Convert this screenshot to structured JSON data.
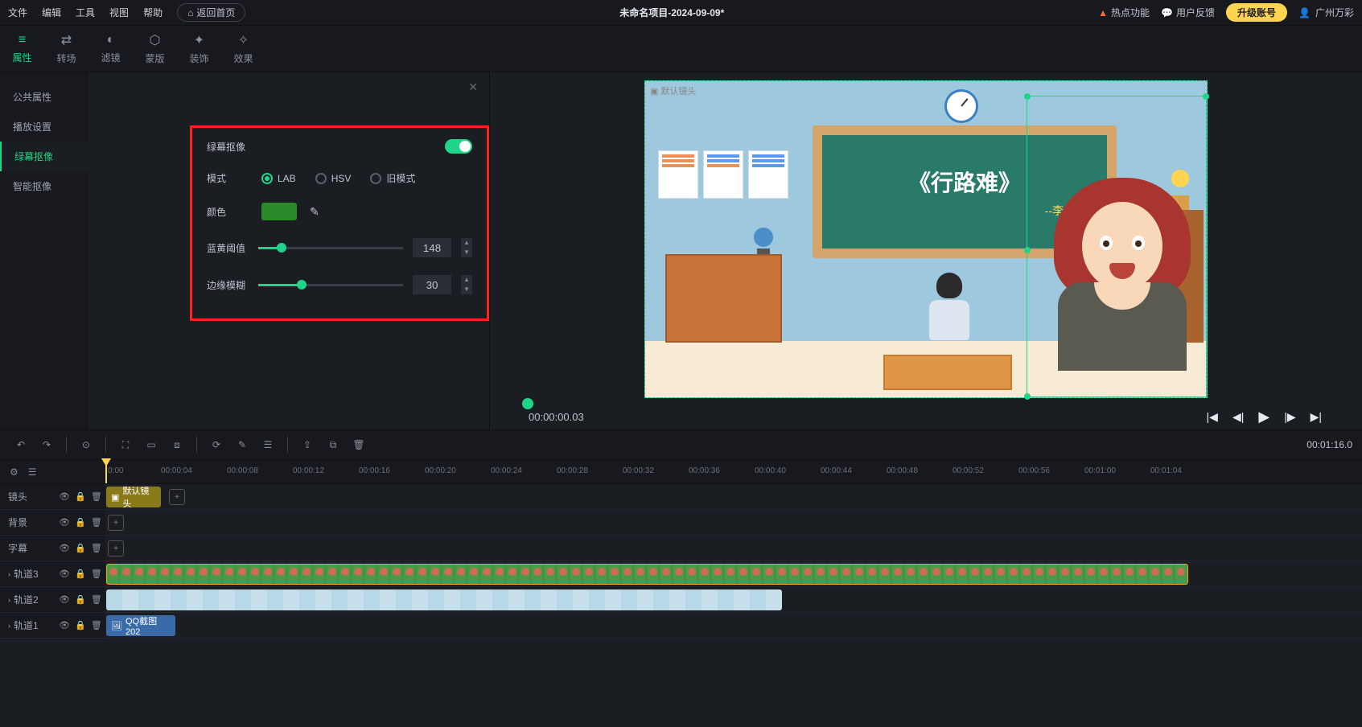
{
  "menubar": {
    "items": [
      "文件",
      "编辑",
      "工具",
      "视图",
      "帮助"
    ],
    "home": "返回首页",
    "title": "未命名项目-2024-09-09*",
    "hot": "热点功能",
    "feedback": "用户反馈",
    "upgrade": "升级账号",
    "user": "广州万彩"
  },
  "tooltabs": [
    {
      "icon": "☰",
      "label": "属性"
    },
    {
      "icon": "⇄",
      "label": "转场"
    },
    {
      "icon": "◐",
      "label": "滤镜"
    },
    {
      "icon": "⬡",
      "label": "蒙版"
    },
    {
      "icon": "✦",
      "label": "装饰"
    },
    {
      "icon": "✧",
      "label": "效果"
    }
  ],
  "sidelist": [
    "公共属性",
    "播放设置",
    "绿幕抠像",
    "智能抠像"
  ],
  "panel": {
    "title": "绿幕抠像",
    "mode_label": "模式",
    "modes": [
      "LAB",
      "HSV",
      "旧模式"
    ],
    "color_label": "颜色",
    "color_value": "#2a8a2a",
    "slider1_label": "蓝黄阈值",
    "slider1_value": "148",
    "slider2_label": "边缘模糊",
    "slider2_value": "30"
  },
  "preview": {
    "cam_label": "默认镜头",
    "blackboard_title": "《行路难》",
    "blackboard_sub": "--李白"
  },
  "playback": {
    "time": "00:00:00.03"
  },
  "tl_toolbar": {
    "duration": "00:01:16.0"
  },
  "ruler_ticks": [
    "0:00",
    "00:00:04",
    "00:00:08",
    "00:00:12",
    "00:00:16",
    "00:00:20",
    "00:00:24",
    "00:00:28",
    "00:00:32",
    "00:00:36",
    "00:00:40",
    "00:00:44",
    "00:00:48",
    "00:00:52",
    "00:00:56",
    "00:01:00",
    "00:01:04"
  ],
  "tracks": {
    "camera": {
      "label": "镜头",
      "clip": "默认镜头"
    },
    "bg": {
      "label": "背景"
    },
    "subtitle": {
      "label": "字幕"
    },
    "t3": {
      "label": "轨道3"
    },
    "t2": {
      "label": "轨道2"
    },
    "t1": {
      "label": "轨道1",
      "clip": "QQ截图202"
    }
  }
}
